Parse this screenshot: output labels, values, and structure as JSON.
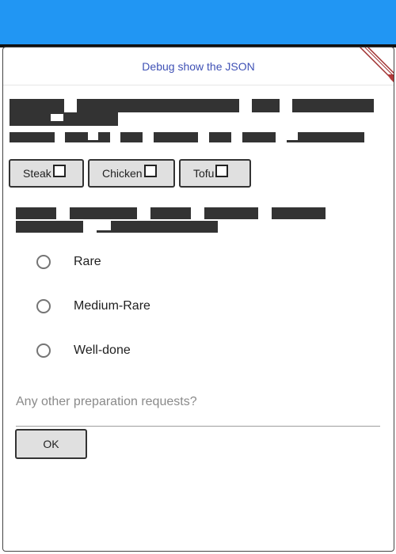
{
  "app": {
    "header_color": "#2196f3"
  },
  "dialog": {
    "debug_link_label": "Debug show the JSON",
    "debug_link_color": "#3f51b5",
    "chips": [
      {
        "label": "Steak",
        "checked": false
      },
      {
        "label": "Chicken",
        "checked": false
      },
      {
        "label": "Tofu",
        "checked": false
      }
    ],
    "doneness_options": [
      {
        "label": "Rare",
        "selected": false
      },
      {
        "label": "Medium-Rare",
        "selected": false
      },
      {
        "label": "Well-done",
        "selected": false
      }
    ],
    "requests_field": {
      "placeholder": "Any other preparation requests?",
      "value": ""
    },
    "ok_label": "OK"
  }
}
